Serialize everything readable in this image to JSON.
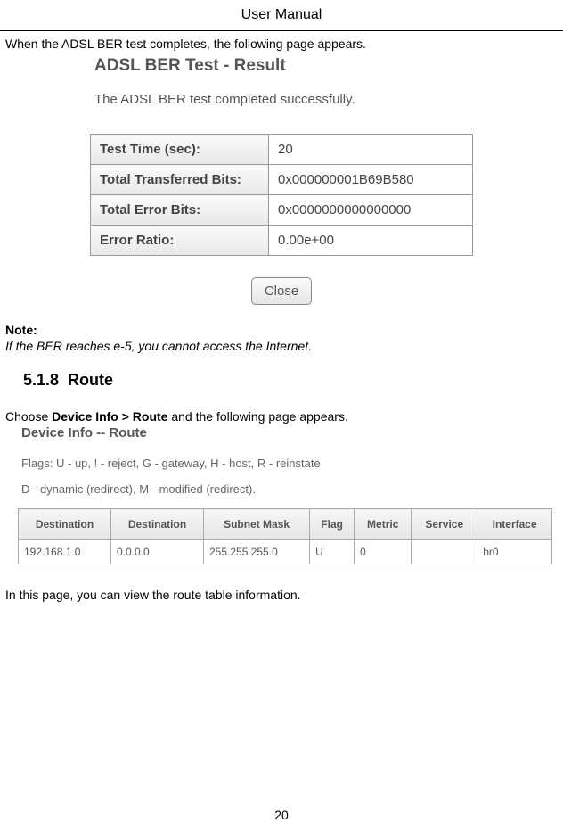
{
  "header": {
    "title": "User Manual"
  },
  "intro": {
    "text": "When the ADSL BER test completes, the following page appears."
  },
  "ber": {
    "title": "ADSL BER Test - Result",
    "success": "The ADSL BER test completed successfully.",
    "rows": [
      {
        "label": "Test Time (sec):",
        "value": "20"
      },
      {
        "label": "Total Transferred Bits:",
        "value": "0x000000001B69B580"
      },
      {
        "label": "Total Error Bits:",
        "value": "0x0000000000000000"
      },
      {
        "label": "Error Ratio:",
        "value": "0.00e+00"
      }
    ],
    "close": "Close"
  },
  "note": {
    "label": "Note:",
    "text": "If the BER reaches e-5, you cannot access the Internet."
  },
  "section": {
    "number": "5.1.8",
    "title": "Route"
  },
  "choose": {
    "prefix": "Choose ",
    "bold": "Device Info > Route",
    "suffix": " and the following page appears."
  },
  "route": {
    "header": "Device Info -- Route",
    "flags1": "Flags: U - up, ! - reject, G - gateway, H - host, R - reinstate",
    "flags2": "D - dynamic (redirect), M - modified (redirect).",
    "columns": [
      "Destination",
      "Destination",
      "Subnet Mask",
      "Flag",
      "Metric",
      "Service",
      "Interface"
    ],
    "rows": [
      [
        "192.168.1.0",
        "0.0.0.0",
        "255.255.255.0",
        "U",
        "0",
        "",
        "br0"
      ]
    ]
  },
  "viewText": "In this page, you can view the route table information.",
  "pageNumber": "20"
}
